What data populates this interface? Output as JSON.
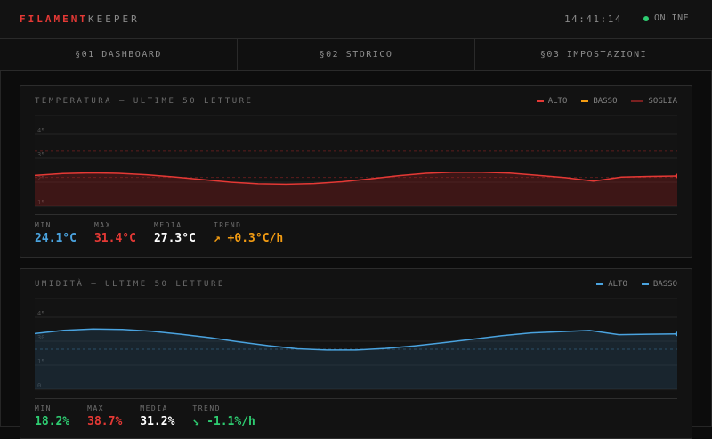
{
  "app": {
    "brand_accent": "FILAMENT",
    "brand_rest": "KEEPER",
    "clock": "14:41:14",
    "status": "ONLINE"
  },
  "tabs": [
    {
      "label": "§01 DASHBOARD"
    },
    {
      "label": "§02 STORICO"
    },
    {
      "label": "§03 IMPOSTAZIONI"
    }
  ],
  "colors": {
    "alto_temp": "#e53935",
    "basso_temp": "#f39c12",
    "soglia": "#7a2020",
    "alto_hum": "#4aa3df",
    "basso_hum": "#4aa3df",
    "min": "#4aa3df",
    "max": "#e53935",
    "media": "#ffffff",
    "trend_temp": "#f39c12",
    "trend_hum": "#2ecc71",
    "online": "#2ecc71"
  },
  "panels": [
    {
      "title": "TEMPERATURA — ULTIME 50 LETTURE",
      "legend": [
        "ALTO",
        "BASSO",
        "SOGLIA"
      ],
      "stats": [
        {
          "label": "MIN",
          "value": "24.1°C"
        },
        {
          "label": "MAX",
          "value": "31.4°C"
        },
        {
          "label": "MEDIA",
          "value": "27.3°C"
        },
        {
          "label": "TREND",
          "value": "↗ +0.3°C/h"
        }
      ]
    },
    {
      "title": "UMIDITÀ — ULTIME 50 LETTURE",
      "legend": [
        "ALTO",
        "BASSO"
      ],
      "stats": [
        {
          "label": "MIN",
          "value": "18.2%"
        },
        {
          "label": "MAX",
          "value": "38.7%"
        },
        {
          "label": "MEDIA",
          "value": "31.2%"
        },
        {
          "label": "TREND",
          "value": "↘ -1.1%/h"
        }
      ]
    }
  ],
  "chart_data": [
    {
      "type": "area",
      "ylim": [
        15,
        45
      ],
      "yticks": [
        "15",
        "25",
        "35",
        "45"
      ],
      "thresholds": [
        38,
        27
      ],
      "series": [
        {
          "name": "ALTO",
          "values": [
            27.8,
            28.6,
            28.9,
            28.7,
            28.1,
            27.2,
            26.1,
            25.0,
            24.3,
            24.1,
            24.4,
            25.2,
            26.4,
            27.7,
            28.7,
            29.2,
            29.2,
            28.8,
            27.9,
            26.9,
            25.5,
            27.1,
            27.4,
            27.6
          ]
        }
      ]
    },
    {
      "type": "area",
      "ylim": [
        0,
        45
      ],
      "yticks": [
        "0",
        "15",
        "30",
        "45"
      ],
      "thresholds": [
        25
      ],
      "series": [
        {
          "name": "ALTO",
          "values": [
            34.8,
            36.8,
            37.6,
            37.4,
            36.2,
            34.4,
            32.2,
            29.6,
            27.2,
            25.3,
            24.5,
            24.5,
            25.5,
            27.1,
            29.1,
            31.3,
            33.5,
            35.2,
            36.0,
            36.7,
            34.1,
            34.4,
            34.6
          ]
        }
      ]
    }
  ]
}
